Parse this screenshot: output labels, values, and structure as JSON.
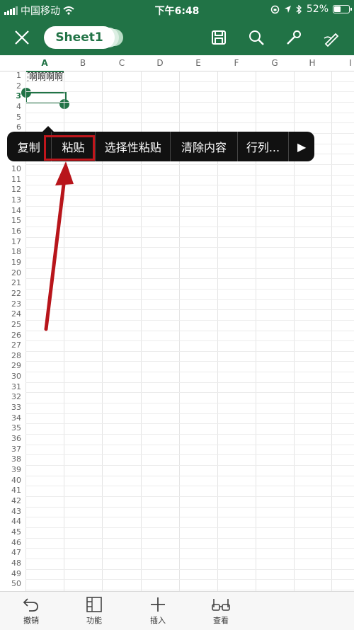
{
  "status": {
    "carrier": "中国移动",
    "time": "下午6:48",
    "battery_percent": "52%",
    "battery_level": 0.52
  },
  "toolbar": {
    "sheet_name": "Sheet1",
    "icons": [
      "close-icon",
      "save-icon",
      "search-icon",
      "settings-wrench-icon",
      "pen-icon"
    ]
  },
  "sheet": {
    "columns": [
      "A",
      "B",
      "C",
      "D",
      "E",
      "F",
      "G",
      "H",
      "I"
    ],
    "selected_column": "A",
    "selected_row": "3",
    "row_count": 50,
    "cell_A1": "啊啊啊啊",
    "accent_color": "#217346"
  },
  "context_menu": {
    "items": [
      {
        "label": "复制"
      },
      {
        "label": "粘贴"
      },
      {
        "label": "选择性粘贴"
      },
      {
        "label": "清除内容"
      },
      {
        "label": "行列..."
      },
      {
        "label": "▶"
      }
    ]
  },
  "bottom_bar": {
    "undo_label": "撤销",
    "functions_label": "功能",
    "insert_label": "插入",
    "view_label": "查看"
  }
}
